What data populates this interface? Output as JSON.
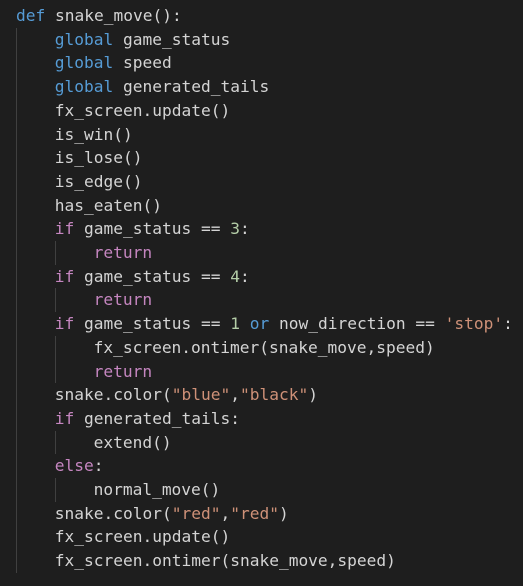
{
  "code": {
    "lines": [
      [
        {
          "t": "def",
          "c": "kw"
        },
        {
          "t": " snake_move():",
          "c": "txt"
        }
      ],
      [
        {
          "t": "global",
          "c": "kw"
        },
        {
          "t": " game_status",
          "c": "txt"
        }
      ],
      [
        {
          "t": "global",
          "c": "kw"
        },
        {
          "t": " speed",
          "c": "txt"
        }
      ],
      [
        {
          "t": "global",
          "c": "kw"
        },
        {
          "t": " generated_tails",
          "c": "txt"
        }
      ],
      [
        {
          "t": "fx_screen.update()",
          "c": "txt"
        }
      ],
      [
        {
          "t": "is_win()",
          "c": "txt"
        }
      ],
      [
        {
          "t": "is_lose()",
          "c": "txt"
        }
      ],
      [
        {
          "t": "is_edge()",
          "c": "txt"
        }
      ],
      [
        {
          "t": "has_eaten()",
          "c": "txt"
        }
      ],
      [
        {
          "t": "if",
          "c": "kc"
        },
        {
          "t": " game_status == ",
          "c": "txt"
        },
        {
          "t": "3",
          "c": "num"
        },
        {
          "t": ":",
          "c": "txt"
        }
      ],
      [
        {
          "t": "return",
          "c": "kc"
        }
      ],
      [
        {
          "t": "if",
          "c": "kc"
        },
        {
          "t": " game_status == ",
          "c": "txt"
        },
        {
          "t": "4",
          "c": "num"
        },
        {
          "t": ":",
          "c": "txt"
        }
      ],
      [
        {
          "t": "return",
          "c": "kc"
        }
      ],
      [
        {
          "t": "if",
          "c": "kc"
        },
        {
          "t": " game_status == ",
          "c": "txt"
        },
        {
          "t": "1",
          "c": "num"
        },
        {
          "t": " ",
          "c": "txt"
        },
        {
          "t": "or",
          "c": "kw"
        },
        {
          "t": " now_direction == ",
          "c": "txt"
        },
        {
          "t": "'stop'",
          "c": "str"
        },
        {
          "t": ":",
          "c": "txt"
        }
      ],
      [
        {
          "t": "fx_screen.ontimer(snake_move,speed)",
          "c": "txt"
        }
      ],
      [
        {
          "t": "return",
          "c": "kc"
        }
      ],
      [
        {
          "t": "snake.color(",
          "c": "txt"
        },
        {
          "t": "\"blue\"",
          "c": "str"
        },
        {
          "t": ",",
          "c": "txt"
        },
        {
          "t": "\"black\"",
          "c": "str"
        },
        {
          "t": ")",
          "c": "txt"
        }
      ],
      [
        {
          "t": "if",
          "c": "kc"
        },
        {
          "t": " generated_tails:",
          "c": "txt"
        }
      ],
      [
        {
          "t": "extend()",
          "c": "txt"
        }
      ],
      [
        {
          "t": "else",
          "c": "kc"
        },
        {
          "t": ":",
          "c": "txt"
        }
      ],
      [
        {
          "t": "normal_move()",
          "c": "txt"
        }
      ],
      [
        {
          "t": "snake.color(",
          "c": "txt"
        },
        {
          "t": "\"red\"",
          "c": "str"
        },
        {
          "t": ",",
          "c": "txt"
        },
        {
          "t": "\"red\"",
          "c": "str"
        },
        {
          "t": ")",
          "c": "txt"
        }
      ],
      [
        {
          "t": "fx_screen.update()",
          "c": "txt"
        }
      ],
      [
        {
          "t": "fx_screen.ontimer(snake_move,speed)",
          "c": "txt"
        }
      ]
    ],
    "indents": [
      0,
      1,
      1,
      1,
      1,
      1,
      1,
      1,
      1,
      1,
      2,
      1,
      2,
      1,
      2,
      2,
      1,
      1,
      2,
      1,
      2,
      1,
      1,
      1
    ]
  }
}
